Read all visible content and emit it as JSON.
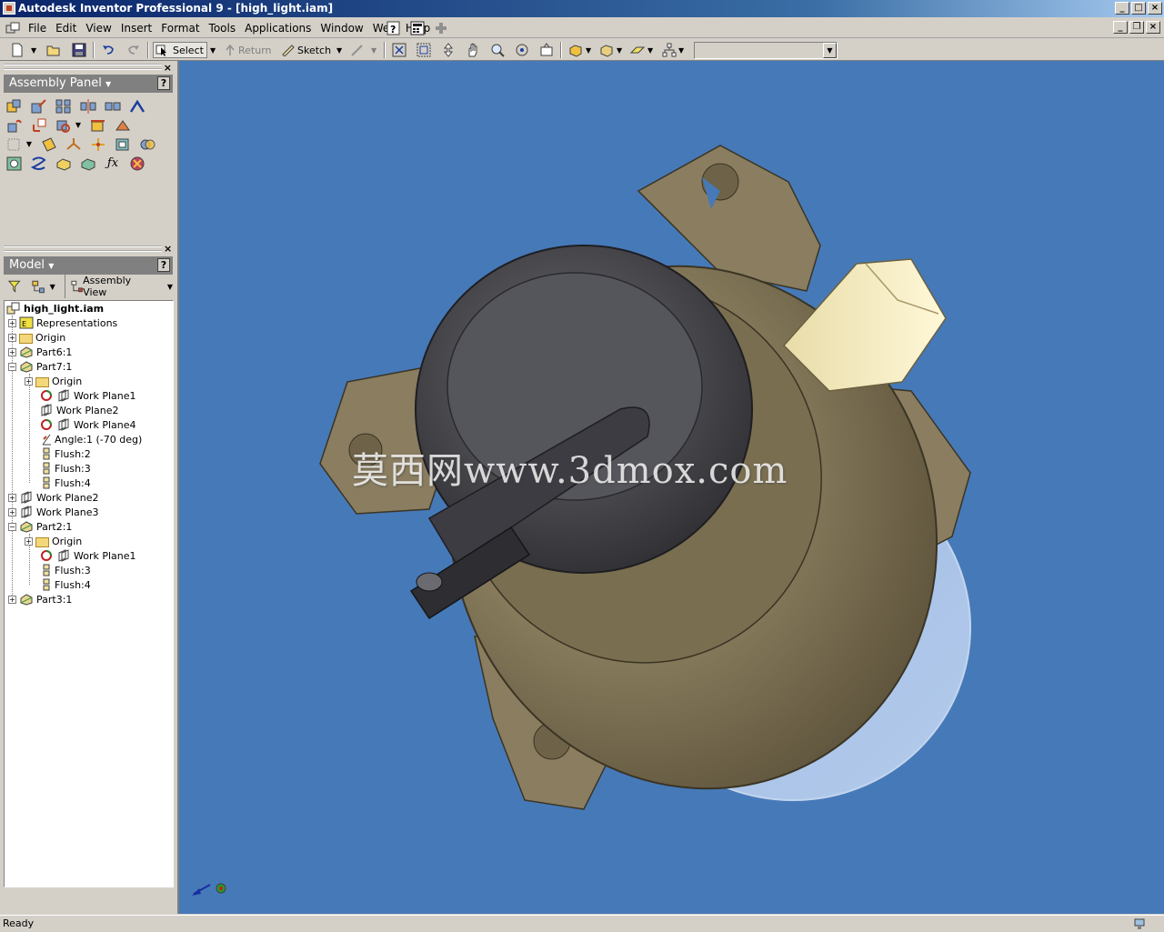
{
  "window": {
    "title": "Autodesk Inventor Professional 9 - [high_light.iam]"
  },
  "menubar": {
    "items": [
      "File",
      "Edit",
      "View",
      "Insert",
      "Format",
      "Tools",
      "Applications",
      "Window",
      "Web",
      "Help"
    ]
  },
  "toolbar": {
    "select_label": "Select",
    "return_label": "Return",
    "sketch_label": "Sketch",
    "style_dropdown_value": ""
  },
  "assembly_panel": {
    "title": "Assembly Panel"
  },
  "model_panel": {
    "title": "Model",
    "view_dropdown": "Assembly View"
  },
  "tree": {
    "nodes": [
      {
        "label": "high_light.iam",
        "icon": "assembly-icon"
      },
      {
        "label": "Representations",
        "icon": "representations-icon"
      },
      {
        "label": "Origin",
        "icon": "folder-icon"
      },
      {
        "label": "Part6:1",
        "icon": "part-icon"
      },
      {
        "label": "Part7:1",
        "icon": "part-icon"
      },
      {
        "label": "Origin",
        "icon": "folder-icon"
      },
      {
        "label": "Work Plane1",
        "icon": "work-plane-icon"
      },
      {
        "label": "Work Plane2",
        "icon": "work-plane-icon"
      },
      {
        "label": "Work Plane4",
        "icon": "work-plane-icon"
      },
      {
        "label": "Angle:1 (-70 deg)",
        "icon": "angle-constraint-icon"
      },
      {
        "label": "Flush:2",
        "icon": "flush-constraint-icon"
      },
      {
        "label": "Flush:3",
        "icon": "flush-constraint-icon"
      },
      {
        "label": "Flush:4",
        "icon": "flush-constraint-icon"
      },
      {
        "label": "Work Plane2",
        "icon": "work-plane-icon"
      },
      {
        "label": "Work Plane3",
        "icon": "work-plane-icon"
      },
      {
        "label": "Part2:1",
        "icon": "part-icon"
      },
      {
        "label": "Origin",
        "icon": "folder-icon"
      },
      {
        "label": "Work Plane1",
        "icon": "work-plane-icon"
      },
      {
        "label": "Flush:3",
        "icon": "flush-constraint-icon"
      },
      {
        "label": "Flush:4",
        "icon": "flush-constraint-icon"
      },
      {
        "label": "Part3:1",
        "icon": "part-icon"
      }
    ]
  },
  "viewport": {
    "background_color": "#4679b8",
    "watermark": "莫西网www.3dmox.com"
  },
  "statusbar": {
    "text": "Ready"
  },
  "colors": {
    "titlebar_start": "#0a246a",
    "titlebar_end": "#a6caf0",
    "chrome": "#d4d0c8",
    "model_body": "#8a7d60",
    "cap": "#4a4a50",
    "connector": "#f0e6b8"
  }
}
